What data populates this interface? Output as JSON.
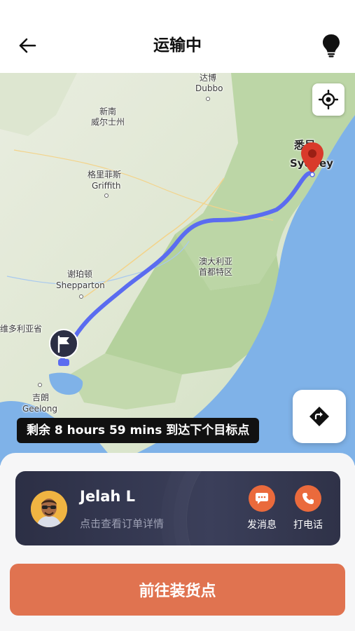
{
  "header": {
    "title": "运输中",
    "back_icon": "arrow-left-icon",
    "right_icon": "lightbulb-icon"
  },
  "map": {
    "labels": {
      "dubbo_cn": "达博",
      "dubbo_en": "Dubbo",
      "nsw": "新南\n威尔士州",
      "griffith_cn": "格里菲斯",
      "griffith_en": "Griffith",
      "sydney_cn": "悉尼",
      "sydney_en": "Sydney",
      "act": "澳大利亚\n首都特区",
      "shepparton_cn": "谢珀顿",
      "shepparton_en": "Shepparton",
      "victoria": "维多利亚省",
      "geelong_cn": "吉朗",
      "geelong_en": "Geelong"
    },
    "route_color": "#5b6cf0",
    "destination_color": "#d93a2b",
    "eta": "剩余 8 hours 59 mins 到达下个目标点"
  },
  "driver": {
    "name": "Jelah L",
    "subtitle": "点击查看订单详情",
    "message_label": "发消息",
    "call_label": "打电话"
  },
  "actions": {
    "primary": "前往装货点"
  },
  "colors": {
    "accent": "#e07350",
    "card_bg": "#2c2f45",
    "action_orange": "#ea6a3c"
  }
}
